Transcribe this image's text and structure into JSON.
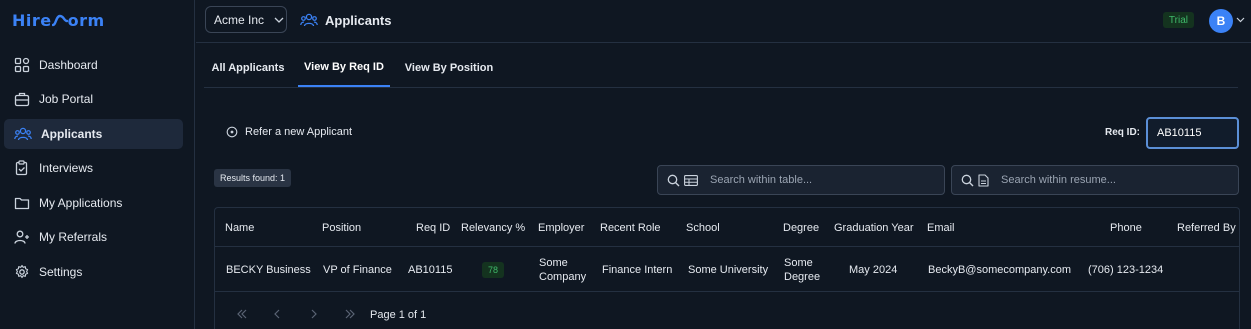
{
  "logo": {
    "text_left": "Hire",
    "text_right": "orm"
  },
  "sidebar": {
    "items": [
      {
        "label": "Dashboard",
        "icon": "dashboard-icon"
      },
      {
        "label": "Job Portal",
        "icon": "briefcase-icon"
      },
      {
        "label": "Applicants",
        "icon": "users-icon",
        "active": true
      },
      {
        "label": "Interviews",
        "icon": "clipboard-icon"
      },
      {
        "label": "My Applications",
        "icon": "folder-icon"
      },
      {
        "label": "My Referrals",
        "icon": "user-plus-icon"
      },
      {
        "label": "Settings",
        "icon": "gear-icon"
      }
    ]
  },
  "header": {
    "company": "Acme Inc",
    "title": "Applicants",
    "trial_badge": "Trial",
    "avatar_initial": "B"
  },
  "tabs": [
    {
      "label": "All Applicants"
    },
    {
      "label": "View By Req ID",
      "active": true
    },
    {
      "label": "View By Position"
    }
  ],
  "toolbar": {
    "refer_label": "Refer a new Applicant",
    "req_label": "Req ID:",
    "req_value": "AB10115",
    "results_label": "Results found: 1",
    "search_table_placeholder": "Search within table...",
    "search_resume_placeholder": "Search within resume..."
  },
  "table": {
    "columns": [
      "Name",
      "Position",
      "Req ID",
      "Relevancy %",
      "Employer",
      "Recent Role",
      "School",
      "Degree",
      "Graduation Year",
      "Email",
      "Phone",
      "Referred By"
    ],
    "rows": [
      {
        "name": "BECKY Business",
        "position": "VP of Finance",
        "req_id": "AB10115",
        "relevancy": "78",
        "employer_line1": "Some",
        "employer_line2": "Company",
        "recent_role": "Finance Intern",
        "school": "Some University",
        "degree_line1": "Some",
        "degree_line2": "Degree",
        "graduation": "May 2024",
        "email": "BeckyB@somecompany.com",
        "phone": "(706) 123-1234",
        "referred_by": ""
      }
    ]
  },
  "pagination": {
    "page_label": "Page 1 of 1"
  },
  "colors": {
    "accent": "#3b82f6",
    "background": "#0f1722",
    "success": "#3fb96a"
  }
}
